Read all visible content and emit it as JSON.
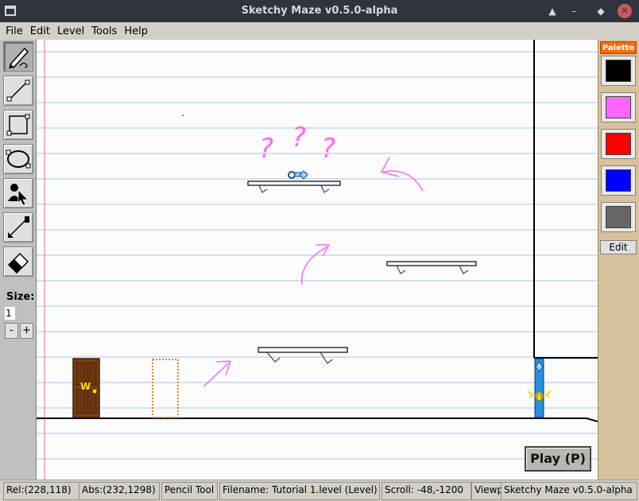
{
  "window": {
    "title": "Sketchy Maze v0.5.0-alpha",
    "controls": [
      "▲",
      "–",
      "◆",
      "✕"
    ]
  },
  "menu": [
    "File",
    "Edit",
    "Level",
    "Tools",
    "Help"
  ],
  "toolbox": {
    "tools": [
      {
        "name": "pencil-tool",
        "icon": "pencil-icon",
        "selected": true
      },
      {
        "name": "line-tool",
        "icon": "line-icon",
        "selected": false
      },
      {
        "name": "rectangle-tool",
        "icon": "rectangle-icon",
        "selected": false
      },
      {
        "name": "ellipse-tool",
        "icon": "ellipse-icon",
        "selected": false
      },
      {
        "name": "actor-tool",
        "icon": "actor-pointer-icon",
        "selected": false
      },
      {
        "name": "link-tool",
        "icon": "link-icon",
        "selected": false
      },
      {
        "name": "eraser-tool",
        "icon": "eraser-icon",
        "selected": false
      }
    ],
    "size_label": "Size:",
    "size_value": "1",
    "size_minus": "-",
    "size_plus": "+"
  },
  "palette": {
    "title": "Palette",
    "swatches": [
      "#000000",
      "#ff66ff",
      "#ff0000",
      "#0000ff",
      "#666666"
    ],
    "edit_label": "Edit"
  },
  "canvas": {
    "door_letter": "W",
    "question_marks": [
      "?",
      "?",
      "?"
    ],
    "colors": {
      "ruled_line": "#a9c5ef",
      "margin_line": "#ff6b6b",
      "ink_pink": "#ff66ff",
      "door": "#7a3f14",
      "blue_actor": "#2a8fe0"
    }
  },
  "play_button": "Play (P)",
  "status": {
    "rel": "Rel:(228,118)",
    "abs": "Abs:(232,1298)",
    "tool": "Pencil Tool",
    "filename": "Filename: Tutorial 1.level (Level)",
    "scroll": "Scroll: -48,-1200",
    "viewport": "Viewp",
    "app": "Sketchy Maze v0.5.0-alpha"
  }
}
